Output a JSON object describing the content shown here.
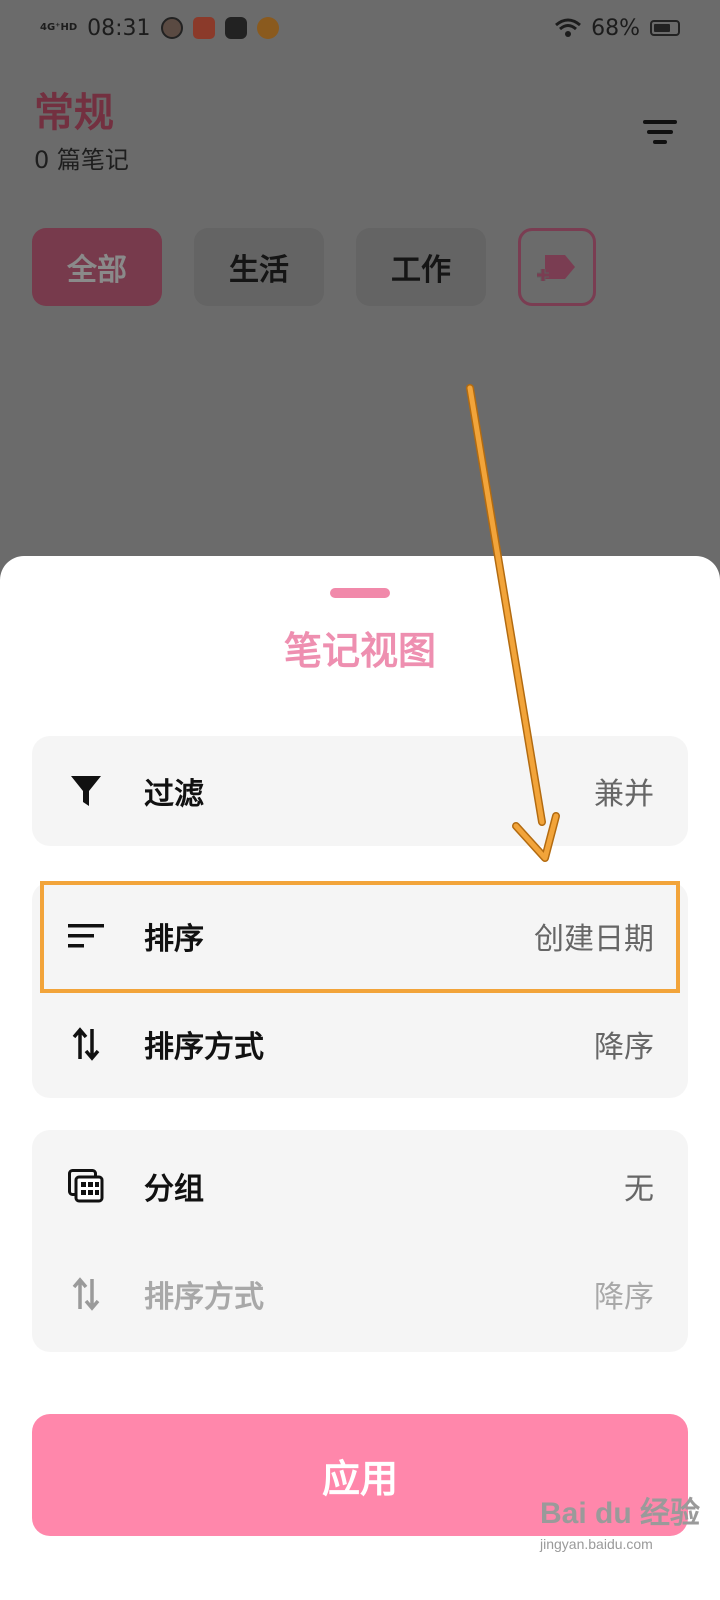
{
  "status_bar": {
    "network": "4G⁺HD",
    "time": "08:31",
    "battery": "68%"
  },
  "header": {
    "title": "常规",
    "note_count": "0 篇笔记"
  },
  "categories": [
    "全部",
    "生活",
    "工作"
  ],
  "sheet": {
    "title": "笔记视图",
    "filter": {
      "label": "过滤",
      "value": "兼并"
    },
    "sort": {
      "label": "排序",
      "value": "创建日期"
    },
    "sort_order": {
      "label": "排序方式",
      "value": "降序"
    },
    "group": {
      "label": "分组",
      "value": "无"
    },
    "group_sort_order": {
      "label": "排序方式",
      "value": "降序"
    },
    "apply_label": "应用"
  },
  "watermark": {
    "main": "Bai du 经验",
    "sub": "jingyan.baidu.com"
  },
  "colors": {
    "accent": "#ff87ab",
    "title_pink": "#ee8fb0",
    "annotation": "#f2a43a"
  }
}
